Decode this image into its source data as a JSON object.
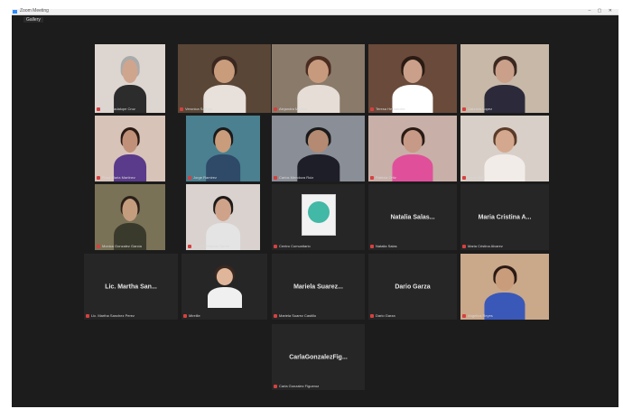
{
  "window": {
    "title": "Zoom Meeting",
    "controls": "– ▢ ✕",
    "view_badge": "Gallery"
  },
  "colors": {
    "background": "#1c1c1c",
    "tile": "#262626",
    "active_speaker_border": "#b8c23a",
    "muted_mic": "#d64040"
  },
  "participants": [
    {
      "caption": "Ma. Guadalupe Cruz",
      "kind": "video"
    },
    {
      "caption": "Veronica Salinas",
      "kind": "video"
    },
    {
      "caption": "Alejandra Medina",
      "kind": "video"
    },
    {
      "caption": "Teresa Hernandez",
      "kind": "video"
    },
    {
      "caption": "Gabriela Lopez",
      "kind": "video"
    },
    {
      "caption": "Rosa Maria Martinez",
      "kind": "video"
    },
    {
      "caption": "Jorge Ramirez",
      "kind": "video"
    },
    {
      "caption": "Carlos Mendoza Ruiz",
      "kind": "video",
      "active": true
    },
    {
      "caption": "Patricia Ortiz",
      "kind": "video"
    },
    {
      "caption": "Laura Rios",
      "kind": "video"
    },
    {
      "caption": "Monica Gonzalez Garcia",
      "kind": "video"
    },
    {
      "caption": "Lucia Fernanda Torres",
      "kind": "video"
    },
    {
      "caption": "Centro Comunitario",
      "kind": "logo"
    },
    {
      "caption": "Natalia Salas",
      "kind": "name",
      "display_name": "Natalia Salas..."
    },
    {
      "caption": "Maria Cristina Alvarez",
      "kind": "name",
      "display_name": "Maria Cristina A..."
    },
    {
      "caption": "Lic. Martha Sanchez Perez",
      "kind": "name",
      "display_name": "Lic. Martha San..."
    },
    {
      "caption": "Mireille",
      "kind": "video"
    },
    {
      "caption": "Mariela Suarez Castillo",
      "kind": "name",
      "display_name": "Mariela Suarez..."
    },
    {
      "caption": "Dario Garza",
      "kind": "name",
      "display_name": "Dario Garza"
    },
    {
      "caption": "Angelica Reyes",
      "kind": "video"
    },
    {
      "caption": "Carla Gonzalez Figueroa",
      "kind": "name",
      "display_name": "CarlaGonzalezFig..."
    }
  ]
}
